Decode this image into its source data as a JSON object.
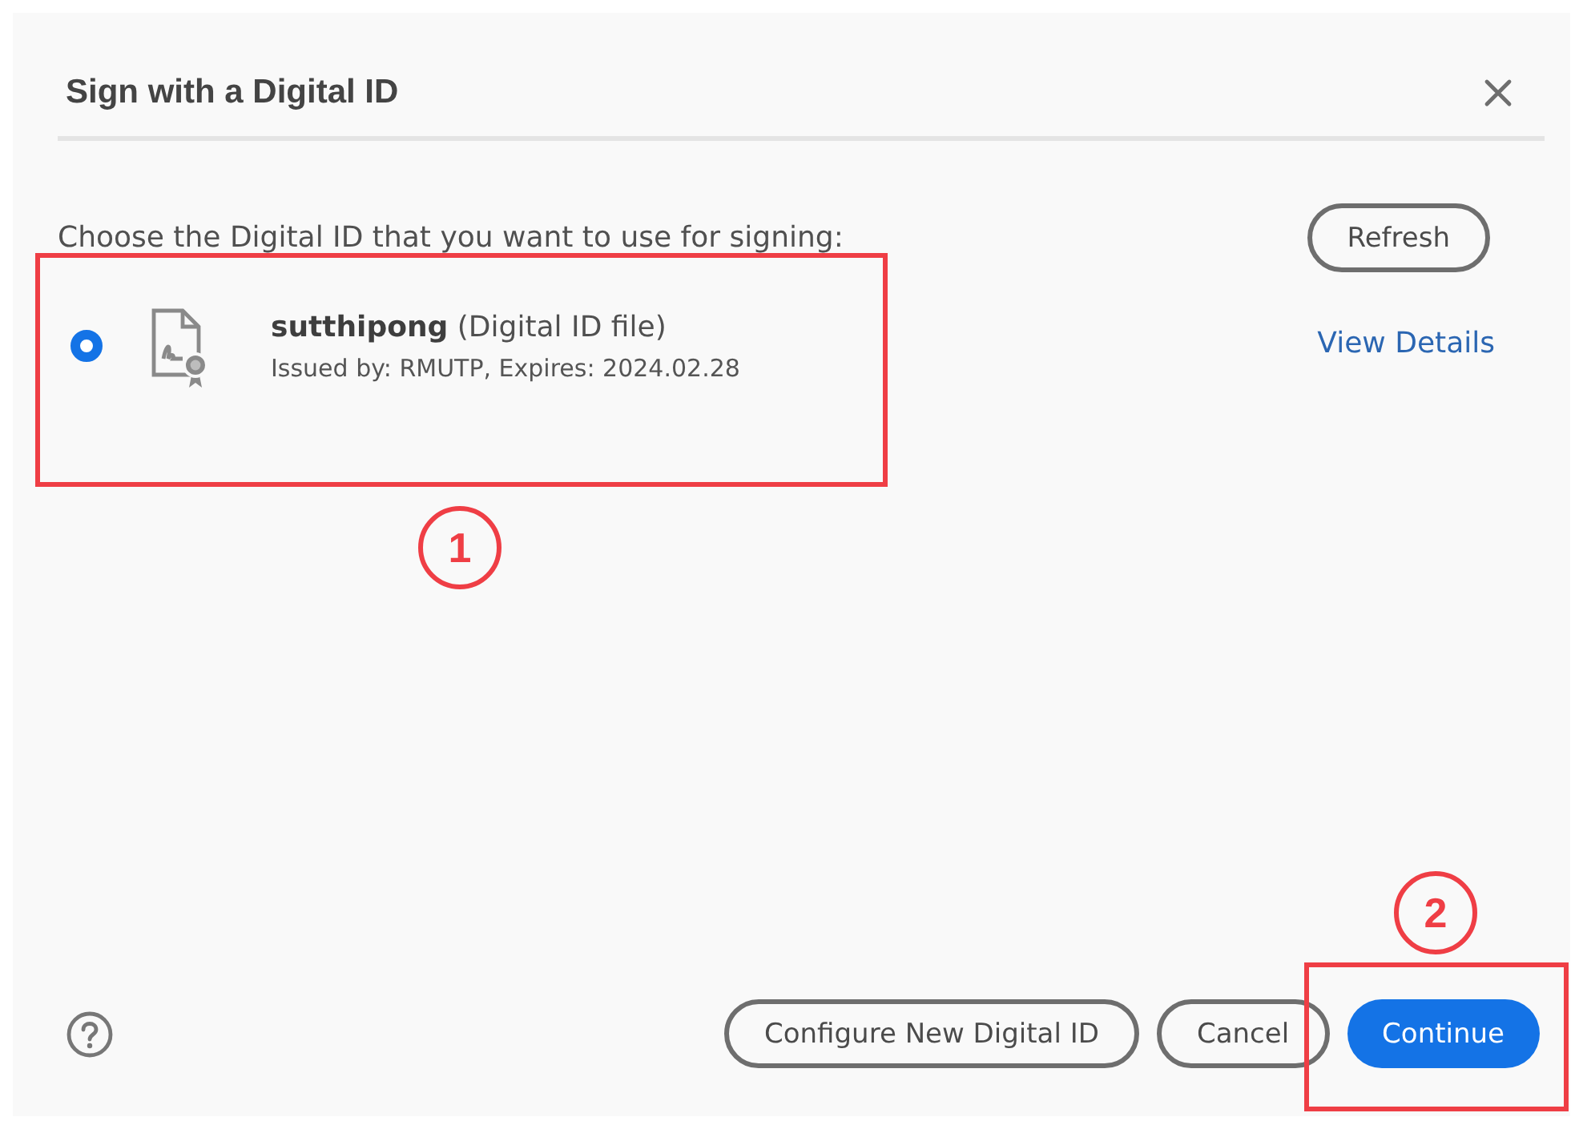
{
  "dialog": {
    "title": "Sign with a Digital ID"
  },
  "prompt": "Choose the Digital ID that you want to use for signing:",
  "refresh_button": "Refresh",
  "ids": [
    {
      "name": "**sutthipong** (Digital ID file)",
      "details": "Issued by: RMUTP, Expires: 2024.02.28",
      "selected": true,
      "link": "View Details"
    }
  ],
  "buttons": [
    {
      "label": "Configure New Digital ID",
      "kind": "outline"
    },
    {
      "label": "Cancel",
      "kind": "outline"
    },
    {
      "label": "Continue",
      "kind": "primary"
    }
  ],
  "annotations": [
    {
      "number": "1"
    },
    {
      "number": "2"
    }
  ]
}
